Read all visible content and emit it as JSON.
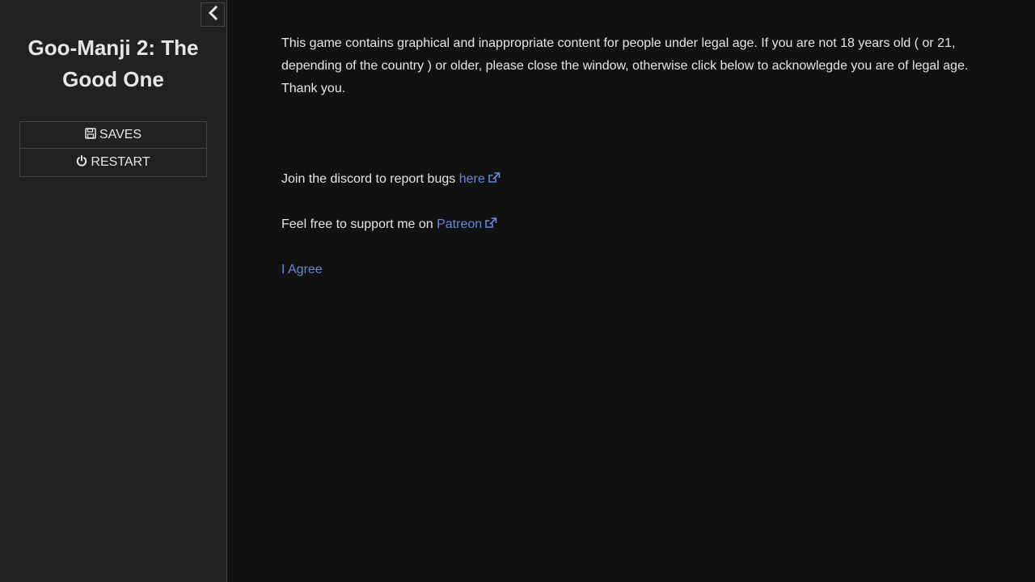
{
  "sidebar": {
    "toggle_icon": "chevron-left-icon",
    "title": "Goo-Manji 2: The Good One",
    "menu": [
      {
        "label": "SAVES",
        "icon": "floppy-disk-icon"
      },
      {
        "label": "RESTART",
        "icon": "power-icon"
      }
    ]
  },
  "passage": {
    "warning": "This game contains graphical and inappropriate content for people under legal age. If you are not 18 years old ( or 21, depending of the country ) or older, please close the window, otherwise click below to acknowlegde you are of legal age. Thank you.",
    "discord_text": "Join the discord to report bugs ",
    "discord_link": "here",
    "patreon_text": "Feel free to support me on ",
    "patreon_link": "Patreon",
    "agree_link": "I Agree"
  },
  "colors": {
    "background": "#111111",
    "sidebar": "#212121",
    "text": "#e6e6e6",
    "link": "#6888dd",
    "border": "#444444"
  }
}
